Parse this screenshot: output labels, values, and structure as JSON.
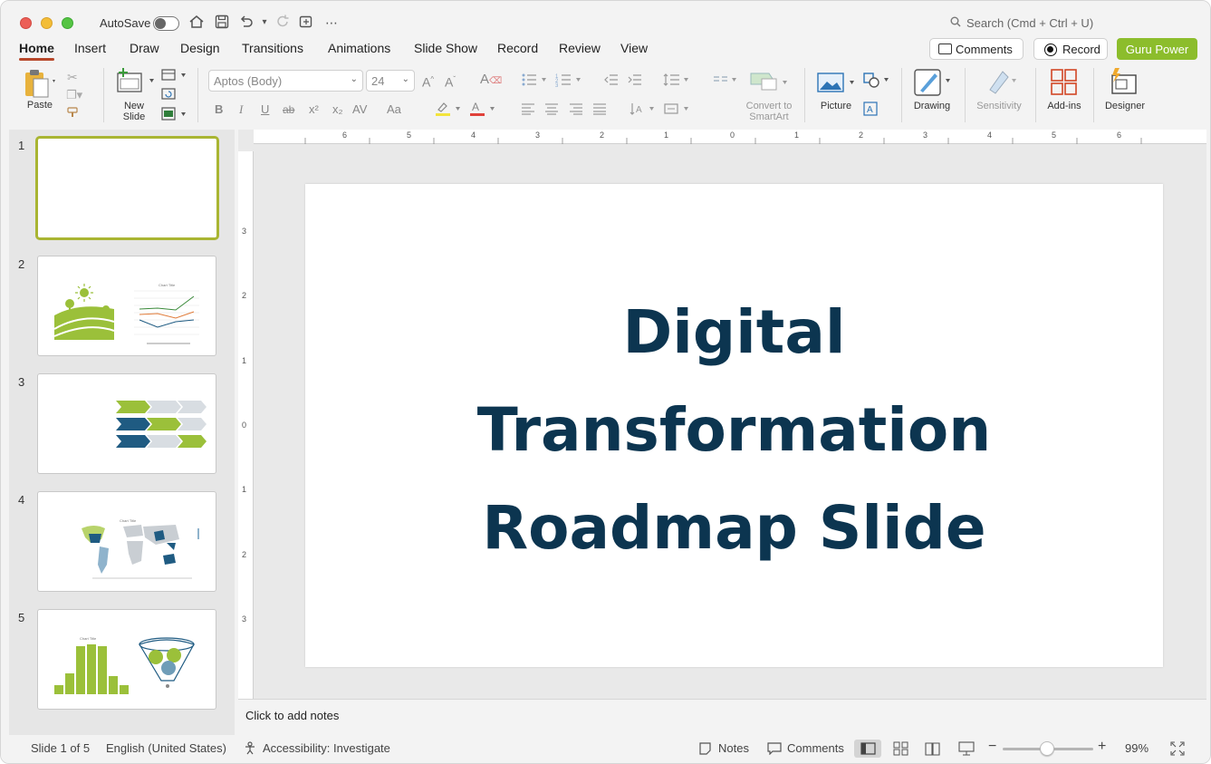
{
  "titlebar": {
    "autosave_label": "AutoSave",
    "search_placeholder": "Search (Cmd + Ctrl + U)"
  },
  "menu": {
    "items": [
      "Home",
      "Insert",
      "Draw",
      "Design",
      "Transitions",
      "Animations",
      "Slide Show",
      "Record",
      "Review",
      "View"
    ],
    "active": "Home",
    "comments_label": "Comments",
    "record_label": "Record",
    "guru_label": "Guru Power",
    "guru_color": "#8cbd2c"
  },
  "ribbon": {
    "paste_label": "Paste",
    "new_slide_label": "New\nSlide",
    "font_name": "Aptos (Body)",
    "font_size": "24",
    "convert_label": "Convert to\nSmartArt",
    "picture_label": "Picture",
    "drawing_label": "Drawing",
    "sensitivity_label": "Sensitivity",
    "addins_label": "Add-ins",
    "designer_label": "Designer",
    "font_buttons": [
      "B",
      "I",
      "U",
      "ab",
      "x²",
      "x₂",
      "AV",
      "Aa"
    ]
  },
  "thumbnails": {
    "numbers": [
      "1",
      "2",
      "3",
      "4",
      "5"
    ],
    "slide2_chart_title": "Chart Title",
    "slide4_chart_title": "Chart Title",
    "slide5_chart_title": "Chart Title"
  },
  "ruler": {
    "h_marks": [
      "6",
      "5",
      "4",
      "3",
      "2",
      "1",
      "0",
      "1",
      "2",
      "3",
      "4",
      "5",
      "6"
    ],
    "v_marks": [
      "3",
      "2",
      "1",
      "0",
      "1",
      "2",
      "3"
    ]
  },
  "slide": {
    "title_lines": [
      "Digital",
      "Transformation",
      "Roadmap Slide"
    ],
    "title_color": "#0c3550"
  },
  "notes": {
    "placeholder": "Click to add notes"
  },
  "status": {
    "slide_count": "Slide 1 of 5",
    "language": "English (United States)",
    "accessibility": "Accessibility: Investigate",
    "notes_label": "Notes",
    "comments_label": "Comments",
    "zoom": "99%"
  },
  "colors": {
    "accent_green": "#9bc03a",
    "accent_navy": "#1f5b82",
    "home_underline": "#b7472a"
  }
}
